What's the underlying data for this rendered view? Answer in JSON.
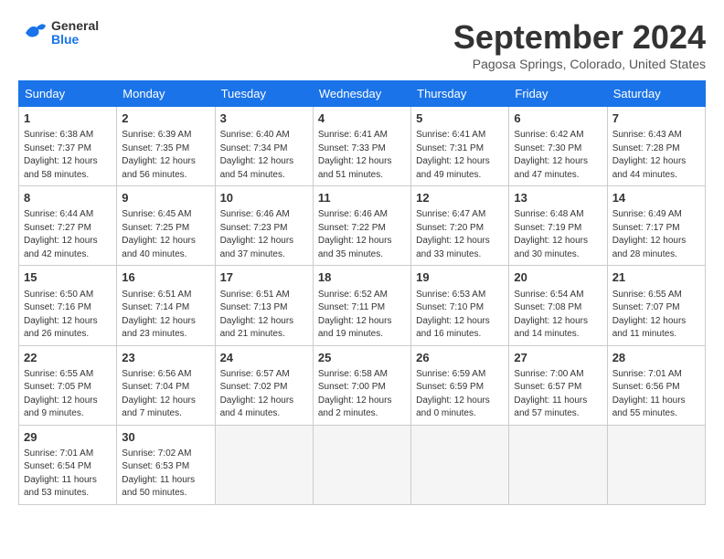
{
  "header": {
    "logo_line1": "General",
    "logo_line2": "Blue",
    "month": "September 2024",
    "location": "Pagosa Springs, Colorado, United States"
  },
  "weekdays": [
    "Sunday",
    "Monday",
    "Tuesday",
    "Wednesday",
    "Thursday",
    "Friday",
    "Saturday"
  ],
  "weeks": [
    [
      {
        "day": "1",
        "info": "Sunrise: 6:38 AM\nSunset: 7:37 PM\nDaylight: 12 hours\nand 58 minutes."
      },
      {
        "day": "2",
        "info": "Sunrise: 6:39 AM\nSunset: 7:35 PM\nDaylight: 12 hours\nand 56 minutes."
      },
      {
        "day": "3",
        "info": "Sunrise: 6:40 AM\nSunset: 7:34 PM\nDaylight: 12 hours\nand 54 minutes."
      },
      {
        "day": "4",
        "info": "Sunrise: 6:41 AM\nSunset: 7:33 PM\nDaylight: 12 hours\nand 51 minutes."
      },
      {
        "day": "5",
        "info": "Sunrise: 6:41 AM\nSunset: 7:31 PM\nDaylight: 12 hours\nand 49 minutes."
      },
      {
        "day": "6",
        "info": "Sunrise: 6:42 AM\nSunset: 7:30 PM\nDaylight: 12 hours\nand 47 minutes."
      },
      {
        "day": "7",
        "info": "Sunrise: 6:43 AM\nSunset: 7:28 PM\nDaylight: 12 hours\nand 44 minutes."
      }
    ],
    [
      {
        "day": "8",
        "info": "Sunrise: 6:44 AM\nSunset: 7:27 PM\nDaylight: 12 hours\nand 42 minutes."
      },
      {
        "day": "9",
        "info": "Sunrise: 6:45 AM\nSunset: 7:25 PM\nDaylight: 12 hours\nand 40 minutes."
      },
      {
        "day": "10",
        "info": "Sunrise: 6:46 AM\nSunset: 7:23 PM\nDaylight: 12 hours\nand 37 minutes."
      },
      {
        "day": "11",
        "info": "Sunrise: 6:46 AM\nSunset: 7:22 PM\nDaylight: 12 hours\nand 35 minutes."
      },
      {
        "day": "12",
        "info": "Sunrise: 6:47 AM\nSunset: 7:20 PM\nDaylight: 12 hours\nand 33 minutes."
      },
      {
        "day": "13",
        "info": "Sunrise: 6:48 AM\nSunset: 7:19 PM\nDaylight: 12 hours\nand 30 minutes."
      },
      {
        "day": "14",
        "info": "Sunrise: 6:49 AM\nSunset: 7:17 PM\nDaylight: 12 hours\nand 28 minutes."
      }
    ],
    [
      {
        "day": "15",
        "info": "Sunrise: 6:50 AM\nSunset: 7:16 PM\nDaylight: 12 hours\nand 26 minutes."
      },
      {
        "day": "16",
        "info": "Sunrise: 6:51 AM\nSunset: 7:14 PM\nDaylight: 12 hours\nand 23 minutes."
      },
      {
        "day": "17",
        "info": "Sunrise: 6:51 AM\nSunset: 7:13 PM\nDaylight: 12 hours\nand 21 minutes."
      },
      {
        "day": "18",
        "info": "Sunrise: 6:52 AM\nSunset: 7:11 PM\nDaylight: 12 hours\nand 19 minutes."
      },
      {
        "day": "19",
        "info": "Sunrise: 6:53 AM\nSunset: 7:10 PM\nDaylight: 12 hours\nand 16 minutes."
      },
      {
        "day": "20",
        "info": "Sunrise: 6:54 AM\nSunset: 7:08 PM\nDaylight: 12 hours\nand 14 minutes."
      },
      {
        "day": "21",
        "info": "Sunrise: 6:55 AM\nSunset: 7:07 PM\nDaylight: 12 hours\nand 11 minutes."
      }
    ],
    [
      {
        "day": "22",
        "info": "Sunrise: 6:55 AM\nSunset: 7:05 PM\nDaylight: 12 hours\nand 9 minutes."
      },
      {
        "day": "23",
        "info": "Sunrise: 6:56 AM\nSunset: 7:04 PM\nDaylight: 12 hours\nand 7 minutes."
      },
      {
        "day": "24",
        "info": "Sunrise: 6:57 AM\nSunset: 7:02 PM\nDaylight: 12 hours\nand 4 minutes."
      },
      {
        "day": "25",
        "info": "Sunrise: 6:58 AM\nSunset: 7:00 PM\nDaylight: 12 hours\nand 2 minutes."
      },
      {
        "day": "26",
        "info": "Sunrise: 6:59 AM\nSunset: 6:59 PM\nDaylight: 12 hours\nand 0 minutes."
      },
      {
        "day": "27",
        "info": "Sunrise: 7:00 AM\nSunset: 6:57 PM\nDaylight: 11 hours\nand 57 minutes."
      },
      {
        "day": "28",
        "info": "Sunrise: 7:01 AM\nSunset: 6:56 PM\nDaylight: 11 hours\nand 55 minutes."
      }
    ],
    [
      {
        "day": "29",
        "info": "Sunrise: 7:01 AM\nSunset: 6:54 PM\nDaylight: 11 hours\nand 53 minutes."
      },
      {
        "day": "30",
        "info": "Sunrise: 7:02 AM\nSunset: 6:53 PM\nDaylight: 11 hours\nand 50 minutes."
      },
      {
        "day": "",
        "info": ""
      },
      {
        "day": "",
        "info": ""
      },
      {
        "day": "",
        "info": ""
      },
      {
        "day": "",
        "info": ""
      },
      {
        "day": "",
        "info": ""
      }
    ]
  ]
}
